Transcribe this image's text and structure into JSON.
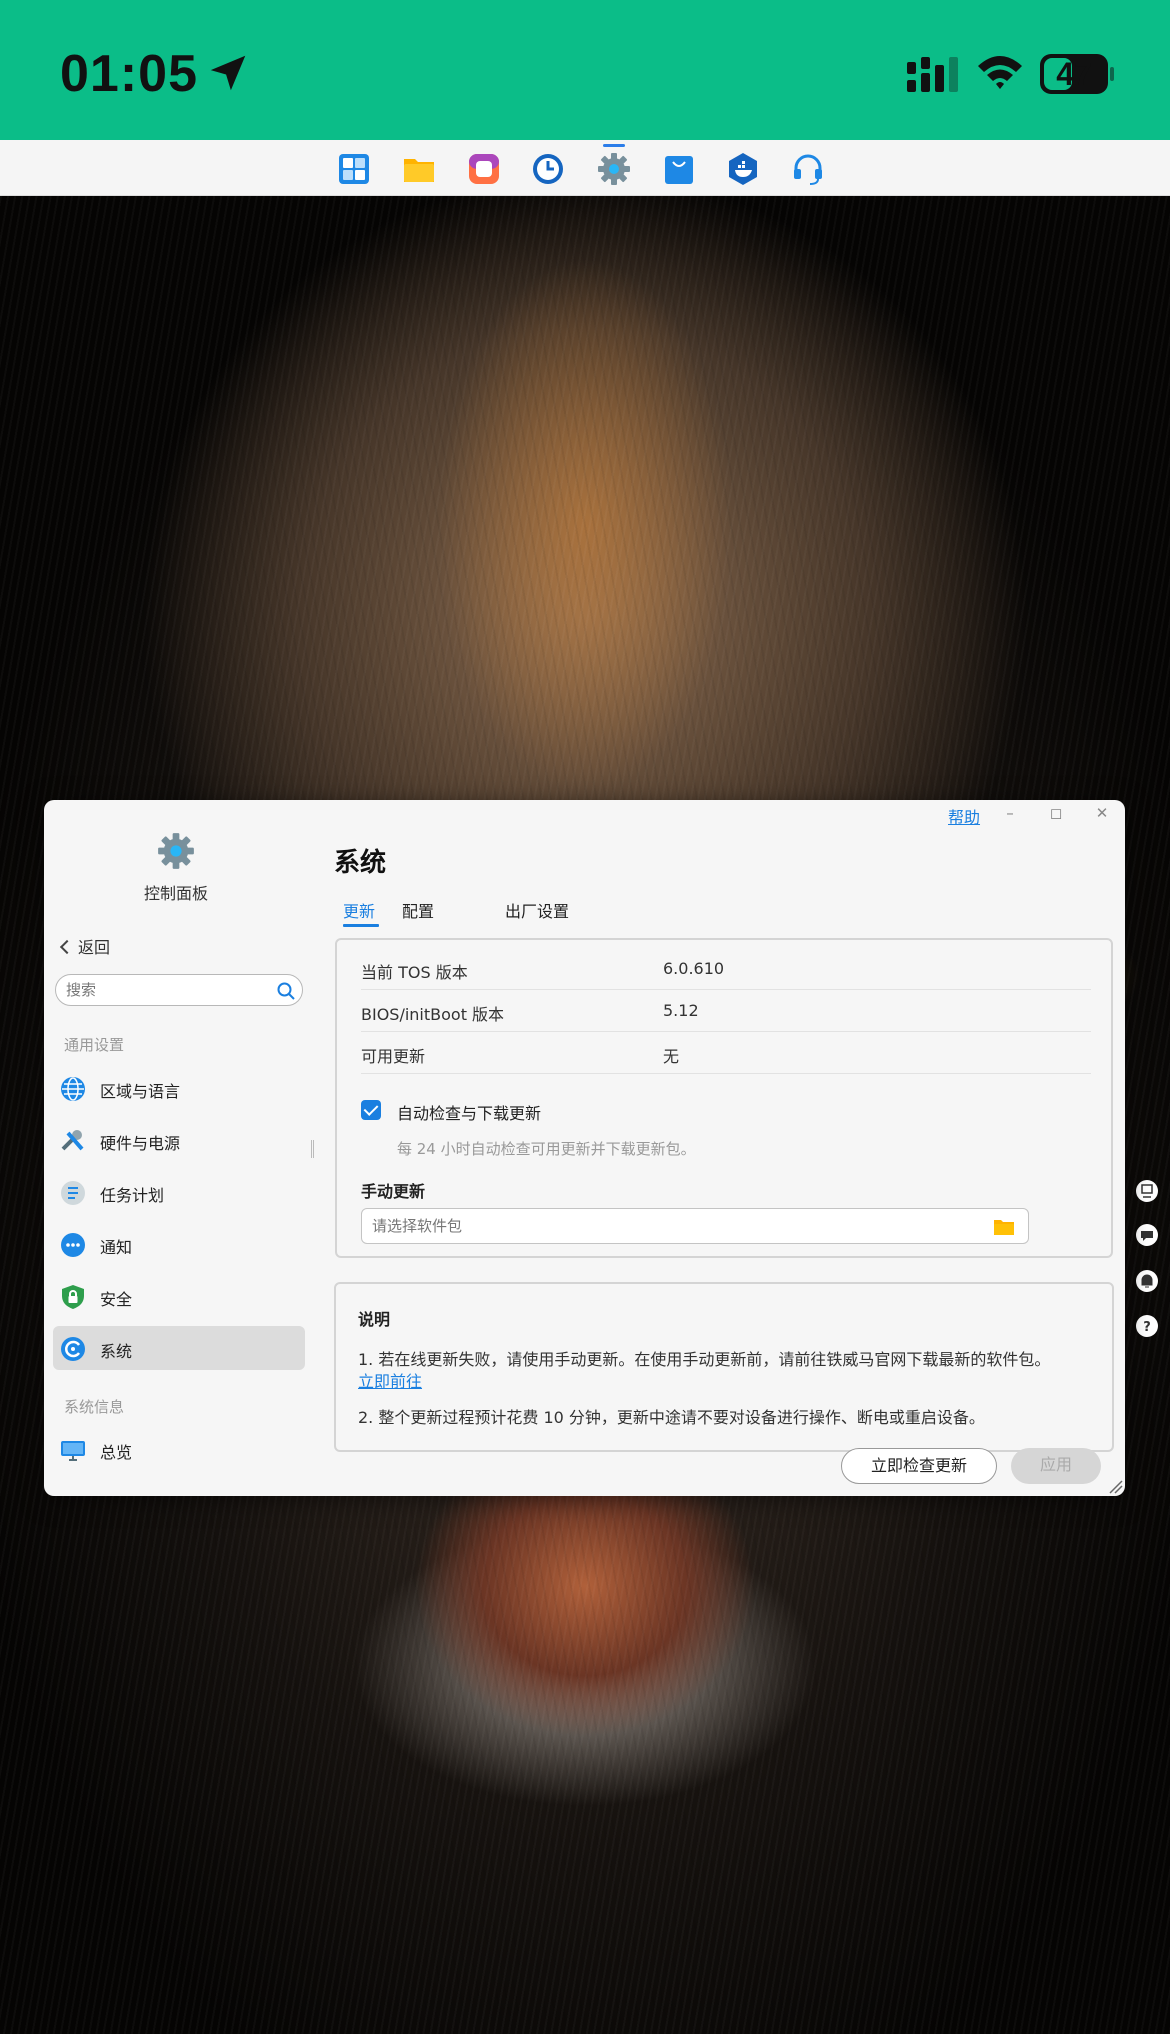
{
  "status_bar": {
    "time": "01:05",
    "battery": "47",
    "battery_level": 0.47
  },
  "taskbar": {
    "apps": [
      {
        "icon": "app-center-icon",
        "color": "#1e88e5"
      },
      {
        "icon": "file-manager-icon",
        "color": "#ffc107"
      },
      {
        "icon": "photos-icon",
        "color": "#e040a0"
      },
      {
        "icon": "backup-clock-icon",
        "color": "#1565c0"
      },
      {
        "icon": "control-panel-gear-icon",
        "color": "#78909c"
      },
      {
        "icon": "store-bag-icon",
        "color": "#1e88e5"
      },
      {
        "icon": "docker-icon",
        "color": "#1565c0"
      },
      {
        "icon": "support-headset-icon",
        "color": "#1e88e5"
      }
    ],
    "active_index": 4
  },
  "window": {
    "help": "帮助",
    "sidebar": {
      "title": "控制面板",
      "back": "返回",
      "search_placeholder": "搜索",
      "sections": [
        {
          "label": "通用设置"
        },
        {
          "label": "系统信息"
        }
      ],
      "items": [
        {
          "label": "区域与语言",
          "icon": "globe-icon"
        },
        {
          "label": "硬件与电源",
          "icon": "tools-icon"
        },
        {
          "label": "任务计划",
          "icon": "task-list-icon"
        },
        {
          "label": "通知",
          "icon": "chat-bubble-icon"
        },
        {
          "label": "安全",
          "icon": "lock-shield-icon"
        },
        {
          "label": "系统",
          "icon": "system-update-icon"
        },
        {
          "label": "总览",
          "icon": "monitor-icon"
        }
      ],
      "active_item": "系统"
    },
    "main": {
      "title": "系统",
      "tabs": [
        {
          "label": "更新"
        },
        {
          "label": "配置"
        },
        {
          "label": "出厂设置"
        }
      ],
      "active_tab": "更新",
      "info": [
        {
          "key": "当前 TOS 版本",
          "value": "6.0.610"
        },
        {
          "key": "BIOS/initBoot 版本",
          "value": "5.12"
        },
        {
          "key": "可用更新",
          "value": "无"
        }
      ],
      "auto_update": {
        "label": "自动检查与下载更新",
        "checked": true,
        "hint": "每 24 小时自动检查可用更新并下载更新包。"
      },
      "manual": {
        "label": "手动更新",
        "placeholder": "请选择软件包"
      },
      "notes": {
        "title": "说明",
        "line1": "1. 若在线更新失败，请使用手动更新。在使用手动更新前，请前往铁威马官网下载最新的软件包。",
        "link": "立即前往",
        "line2": "2. 整个更新过程预计花费 10 分钟，更新中途请不要对设备进行操作、断电或重启设备。"
      },
      "buttons": {
        "check": "立即检查更新",
        "apply": "应用"
      }
    }
  },
  "colors": {
    "status_bar": "#0bbd88",
    "accent": "#1a7fe0"
  }
}
